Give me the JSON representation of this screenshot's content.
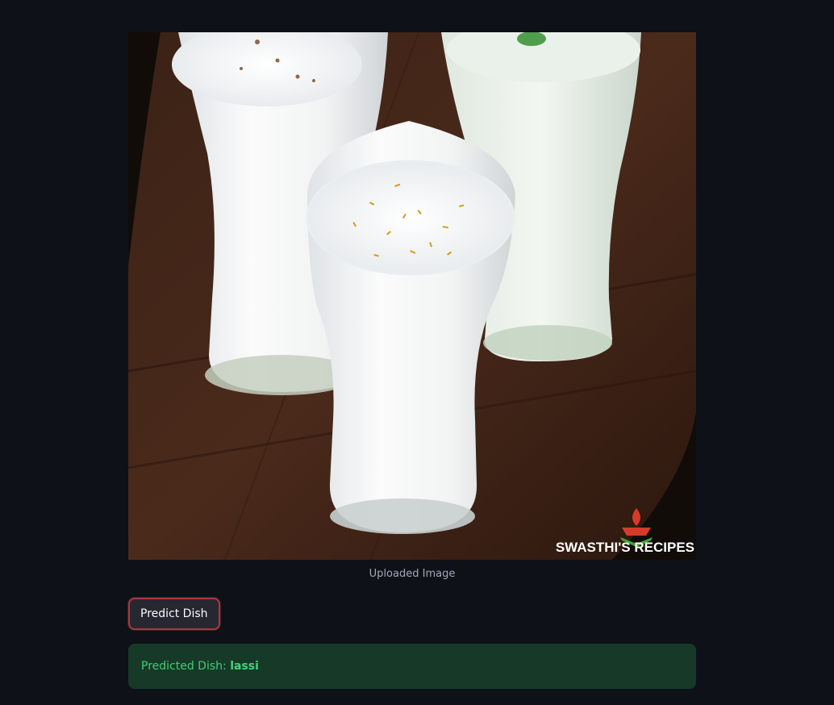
{
  "image": {
    "watermark_text": "SWASTHI'S RECIPES",
    "logo_icon": "chef-hat-logo-icon",
    "caption": "Uploaded Image"
  },
  "actions": {
    "predict_label": "Predict Dish"
  },
  "result": {
    "label": "Predicted Dish:",
    "value": "lassi"
  },
  "colors": {
    "background": "#0e1117",
    "button_border": "#a33a3f",
    "success_bg": "#173928",
    "success_text": "#3ecf75"
  }
}
